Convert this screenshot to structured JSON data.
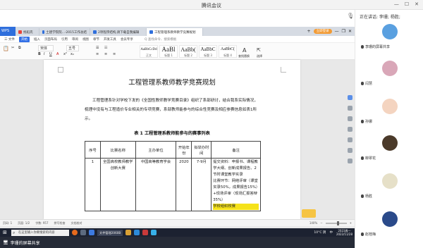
{
  "window": {
    "title": "腾讯会议"
  },
  "browser_tabs": [
    {
      "label": "首页",
      "color": "#2f6fdc"
    },
    {
      "label": "找稻壳",
      "color": "#e8443a"
    },
    {
      "label": "土建学院院...-2015工作总结",
      "color": "#2f6fdc"
    },
    {
      "label": "2项程序结构,请下载自我编辑",
      "color": "#2f6fdc"
    },
    {
      "label": "工程管理系教师教学竞赛规划",
      "color": "#2f6fdc"
    }
  ],
  "login_label": "立即登录",
  "menus": [
    "三 文件",
    "开始",
    "插入",
    "页面布局",
    "引用",
    "审阅",
    "视图",
    "章节",
    "开发工具",
    "会员专享"
  ],
  "menu_search": "Q 查找命令、搜索模板",
  "ribbon": {
    "font_name": "宋体",
    "font_size": "五号",
    "styles": [
      {
        "big": "AaBbCcDd",
        "small": "正文"
      },
      {
        "big": "AaBl",
        "small": "标题 1"
      },
      {
        "big": "AaBb(",
        "small": "标题 2"
      },
      {
        "big": "AaBbC",
        "small": "标题 3"
      },
      {
        "big": "AaBbC(",
        "small": "标题 4"
      }
    ],
    "find_label": "查找替换",
    "select_label": "选择"
  },
  "document": {
    "title": "工程管理系教师教学竞赛规划",
    "paragraph": "工程管理系针对学校下发的《全国性教师教学竞赛目录》组织了系部研讨，结合我系实际情况，梳理中没有与工程造价专业相关的专项竞赛，系部教师能参与的综合性竞赛及相应参赛信息如表1所示。",
    "table_caption": "表 1 工程管理系教师能参与的赛事列表",
    "table_headers": [
      "序号",
      "比赛名称",
      "主办单位",
      "开始年份",
      "拟举办时间",
      "备注"
    ],
    "table_rows": [
      {
        "no": "1",
        "name": "全国高校教师教学创新大赛",
        "organizer": "中国高等教育学会",
        "year": "2020",
        "time": "7-9月",
        "note": "提交资料：申报书、课程教学大纲、创新成果报告、2节时课堂教学实录",
        "note2": "比赛环节：网络评审（课堂实录50%，成果报告15%）+现场评审（现场汇报答辩35%）",
        "note3": "学校组织校赛"
      }
    ]
  },
  "statusbar": {
    "page": "页码: 1",
    "pages": "页面: 1/2",
    "words": "字数: 957",
    "spell": "拼写检查",
    "doc_check": "文档校对",
    "zoom": "140%"
  },
  "taskbar": {
    "search_placeholder": "在这里输入你要搜索的内容",
    "task_label": "文件管理2060B",
    "weather": "10°C 阴",
    "ime": "中",
    "time": "2023周一",
    "date": "2022/11/28"
  },
  "share": {
    "label": "李珊的屏幕共享"
  },
  "panel": {
    "speaking": "正在讲话: 李珊; 杨胜;",
    "participants": [
      {
        "name": "李珊的屏幕共享",
        "avatar_color": "#5aa0e0"
      },
      {
        "name": "闫慧",
        "avatar_color": "#d9a7b8"
      },
      {
        "name": "孙娜",
        "avatar_color": "#f4d4c0"
      },
      {
        "name": "柳翠花",
        "avatar_color": "#4b3a2a"
      },
      {
        "name": "杨胜",
        "avatar_color": "#e6e0c8"
      },
      {
        "name": "赵桂梅",
        "avatar_color": "#2a4a8a"
      }
    ]
  }
}
